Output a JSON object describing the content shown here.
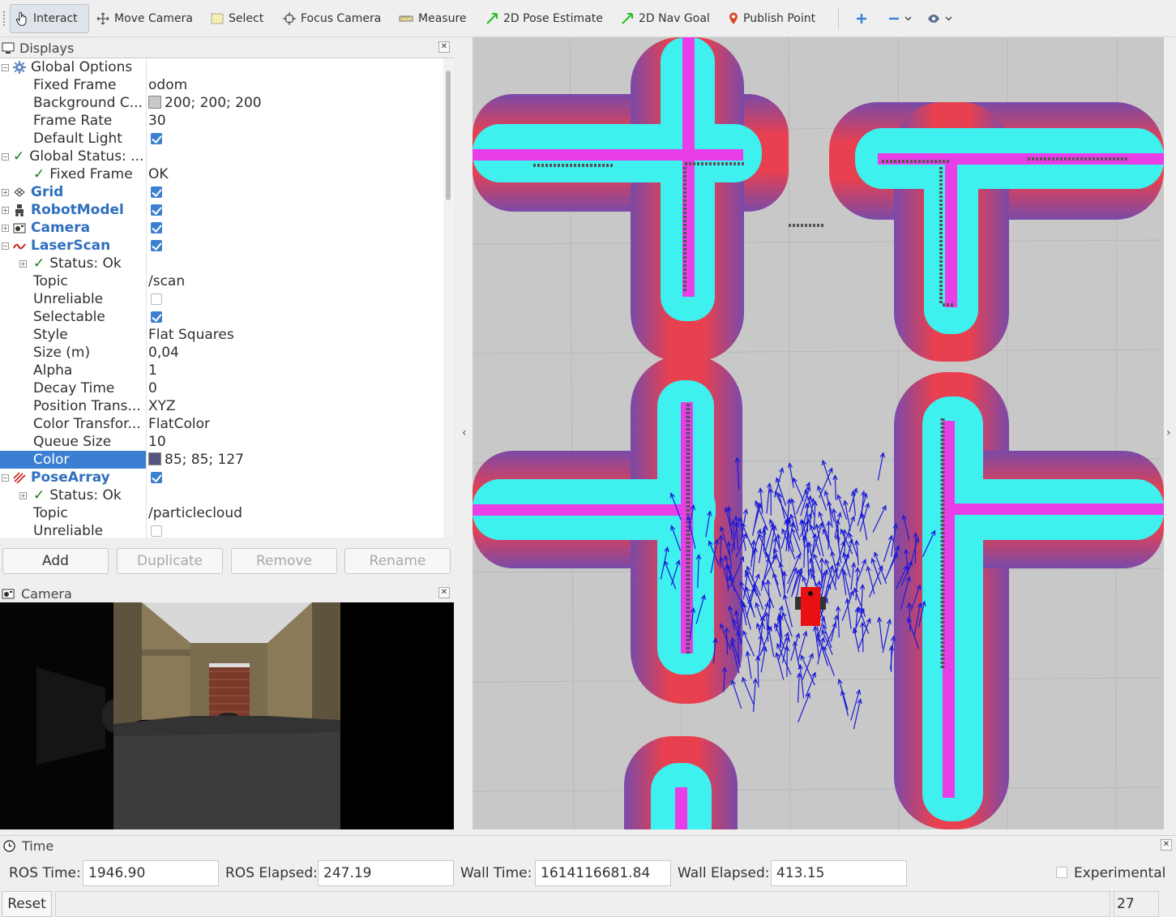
{
  "toolbar": {
    "interact": "Interact",
    "move_camera": "Move Camera",
    "select": "Select",
    "focus_camera": "Focus Camera",
    "measure": "Measure",
    "pose_estimate": "2D Pose Estimate",
    "nav_goal": "2D Nav Goal",
    "publish_point": "Publish Point"
  },
  "displays_panel": {
    "title": "Displays",
    "rows": [
      {
        "key": "Global Options",
        "value": ""
      },
      {
        "key": "Fixed Frame",
        "value": "odom"
      },
      {
        "key": "Background C...",
        "value": "200; 200; 200",
        "swatch": "#c8c8c8"
      },
      {
        "key": "Frame Rate",
        "value": "30"
      },
      {
        "key": "Default Light",
        "checked": true
      },
      {
        "key": "Global Status: ...",
        "value": ""
      },
      {
        "key": "Fixed Frame",
        "value": "OK"
      },
      {
        "key": "Grid",
        "checked": true
      },
      {
        "key": "RobotModel",
        "checked": true
      },
      {
        "key": "Camera",
        "checked": true
      },
      {
        "key": "LaserScan",
        "checked": true
      },
      {
        "key": "Status: Ok",
        "value": ""
      },
      {
        "key": "Topic",
        "value": "/scan"
      },
      {
        "key": "Unreliable",
        "checked": false
      },
      {
        "key": "Selectable",
        "checked": true
      },
      {
        "key": "Style",
        "value": "Flat Squares"
      },
      {
        "key": "Size (m)",
        "value": "0,04"
      },
      {
        "key": "Alpha",
        "value": "1"
      },
      {
        "key": "Decay Time",
        "value": "0"
      },
      {
        "key": "Position Trans...",
        "value": "XYZ"
      },
      {
        "key": "Color Transfor...",
        "value": "FlatColor"
      },
      {
        "key": "Queue Size",
        "value": "10"
      },
      {
        "key": "Color",
        "value": "85; 85; 127",
        "swatch": "#55557f"
      },
      {
        "key": "PoseArray",
        "checked": true
      },
      {
        "key": "Status: Ok",
        "value": ""
      },
      {
        "key": "Topic",
        "value": "/particlecloud"
      },
      {
        "key": "Unreliable",
        "checked": false
      }
    ],
    "buttons": {
      "add": "Add",
      "duplicate": "Duplicate",
      "remove": "Remove",
      "rename": "Rename"
    }
  },
  "camera_panel": {
    "title": "Camera"
  },
  "time_panel": {
    "title": "Time",
    "ros_time_label": "ROS Time:",
    "ros_time": "1946.90",
    "ros_elapsed_label": "ROS Elapsed:",
    "ros_elapsed": "247.19",
    "wall_time_label": "Wall Time:",
    "wall_time": "1614116681.84",
    "wall_elapsed_label": "Wall Elapsed:",
    "wall_elapsed": "413.15",
    "experimental_label": "Experimental",
    "reset_label": "Reset",
    "fps": "27 fps"
  },
  "colors": {
    "accent": "#3b7fd2",
    "display_name": "#2f6fbe",
    "costmap_cyan": "#3ef0ee",
    "costmap_magenta": "#e83ee8",
    "costmap_red": "#e8404f",
    "costmap_purple": "#7a4aa8",
    "particles": "#1a1ad8",
    "robot": "#e81010"
  }
}
